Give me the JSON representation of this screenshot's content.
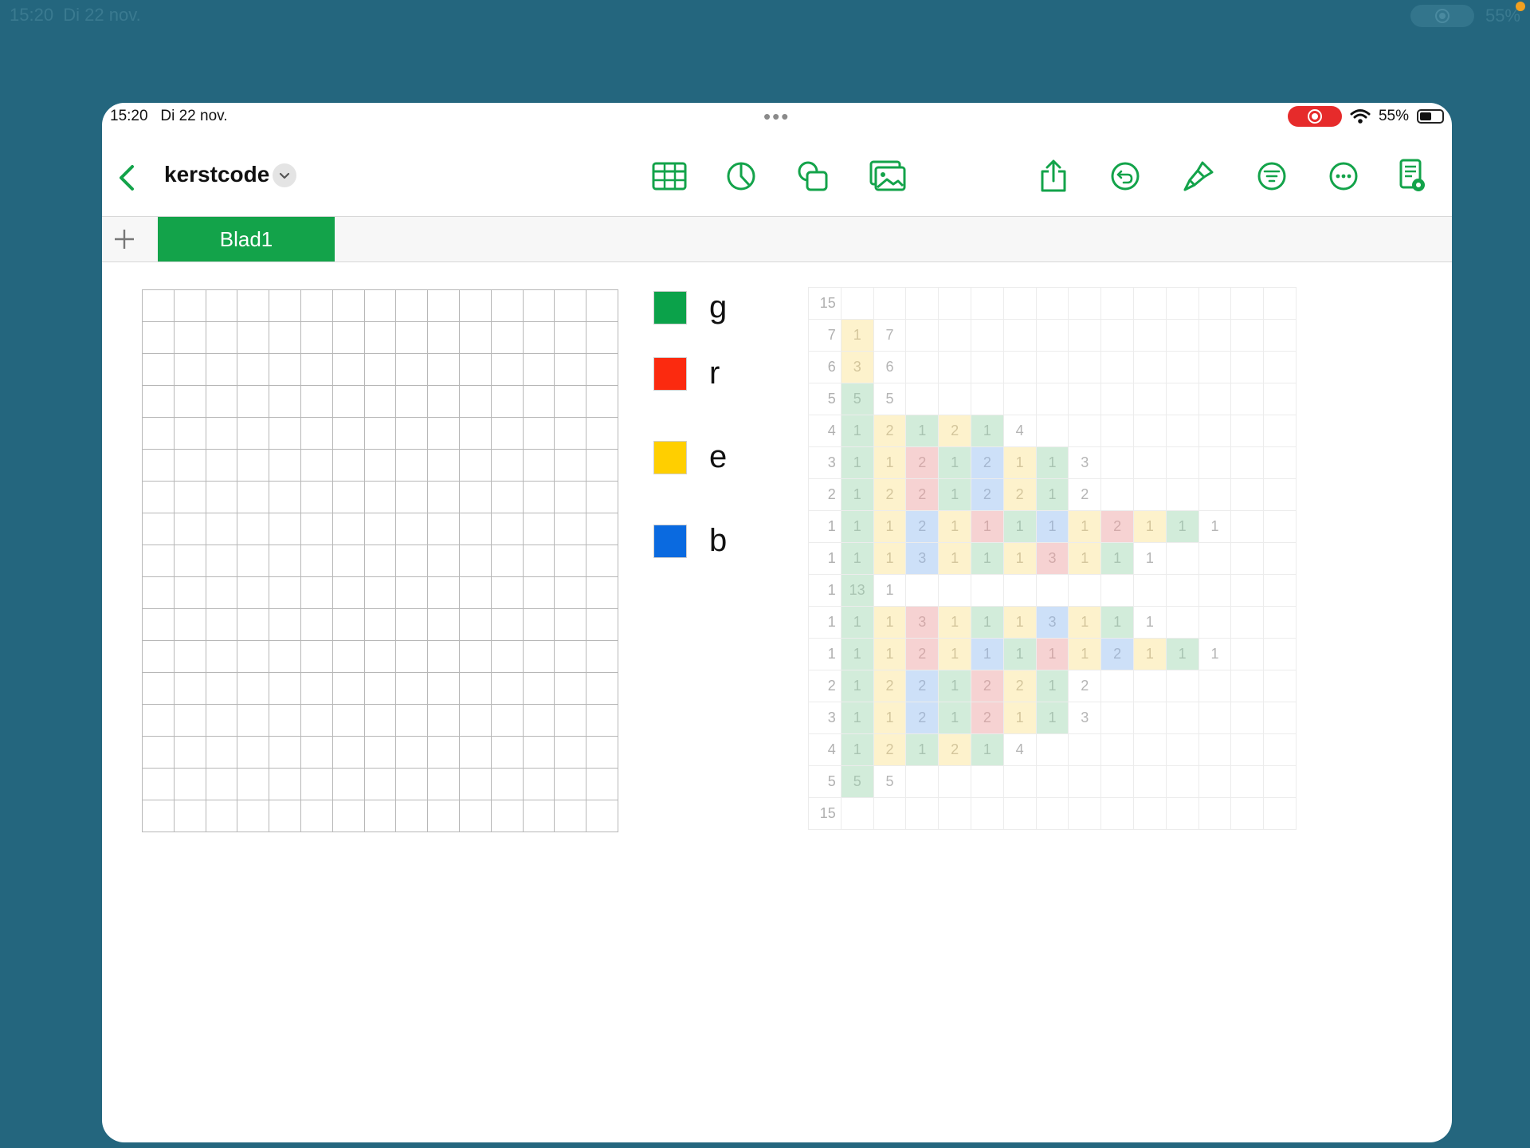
{
  "outer_status": {
    "time": "15:20",
    "date": "Di 22 nov.",
    "battery": "55%"
  },
  "status": {
    "time": "15:20",
    "date": "Di 22 nov.",
    "battery_percent": "55%",
    "battery_level": 0.55
  },
  "document": {
    "title": "kerstcode"
  },
  "toolbar": {
    "left": [
      {
        "name": "back-button",
        "icon": "chevron-left-icon",
        "interactable": true
      }
    ],
    "insert": [
      {
        "name": "table-button",
        "icon": "table-icon"
      },
      {
        "name": "chart-button",
        "icon": "chart-icon"
      },
      {
        "name": "shape-button",
        "icon": "shape-icon"
      },
      {
        "name": "media-button",
        "icon": "media-icon"
      }
    ],
    "actions": [
      {
        "name": "share-button",
        "icon": "share-icon"
      },
      {
        "name": "undo-button",
        "icon": "undo-icon"
      },
      {
        "name": "format-button",
        "icon": "paintbrush-icon"
      },
      {
        "name": "organize-button",
        "icon": "filter-icon"
      },
      {
        "name": "more-button",
        "icon": "ellipsis-icon"
      },
      {
        "name": "reader-button",
        "icon": "reader-view-icon"
      }
    ]
  },
  "sheets": {
    "tabs": [
      {
        "label": "Blad1",
        "active": true
      }
    ]
  },
  "colors": {
    "accent": "#13a34a",
    "g": "#0ba24a",
    "r": "#fb2a0f",
    "e": "#ffcf00",
    "b": "#0a6ae0"
  },
  "legend": [
    {
      "key": "g",
      "label": "g",
      "color": "#0ba24a"
    },
    {
      "key": "r",
      "label": "r",
      "color": "#fb2a0f"
    },
    {
      "key": "e",
      "label": "e",
      "color": "#ffcf00"
    },
    {
      "key": "b",
      "label": "b",
      "color": "#0a6ae0"
    }
  ],
  "empty_grid": {
    "rows": 17,
    "cols": 15
  },
  "clue_grid": {
    "columns": 15,
    "rows": [
      {
        "lead": "15",
        "cells": []
      },
      {
        "lead": "7",
        "cells": [
          [
            "e",
            "1"
          ],
          [
            "",
            "7"
          ]
        ]
      },
      {
        "lead": "6",
        "cells": [
          [
            "e",
            "3"
          ],
          [
            "",
            "6"
          ]
        ]
      },
      {
        "lead": "5",
        "cells": [
          [
            "g",
            "5"
          ],
          [
            "",
            "5"
          ]
        ]
      },
      {
        "lead": "4",
        "cells": [
          [
            "g",
            "1"
          ],
          [
            "e",
            "2"
          ],
          [
            "g",
            "1"
          ],
          [
            "e",
            "2"
          ],
          [
            "g",
            "1"
          ],
          [
            "",
            "4"
          ]
        ]
      },
      {
        "lead": "3",
        "cells": [
          [
            "g",
            "1"
          ],
          [
            "e",
            "1"
          ],
          [
            "r",
            "2"
          ],
          [
            "g",
            "1"
          ],
          [
            "b",
            "2"
          ],
          [
            "e",
            "1"
          ],
          [
            "g",
            "1"
          ],
          [
            "",
            "3"
          ]
        ]
      },
      {
        "lead": "2",
        "cells": [
          [
            "g",
            "1"
          ],
          [
            "e",
            "2"
          ],
          [
            "r",
            "2"
          ],
          [
            "g",
            "1"
          ],
          [
            "b",
            "2"
          ],
          [
            "e",
            "2"
          ],
          [
            "g",
            "1"
          ],
          [
            "",
            "2"
          ]
        ]
      },
      {
        "lead": "1",
        "cells": [
          [
            "g",
            "1"
          ],
          [
            "e",
            "1"
          ],
          [
            "b",
            "2"
          ],
          [
            "e",
            "1"
          ],
          [
            "r",
            "1"
          ],
          [
            "g",
            "1"
          ],
          [
            "b",
            "1"
          ],
          [
            "e",
            "1"
          ],
          [
            "r",
            "2"
          ],
          [
            "e",
            "1"
          ],
          [
            "g",
            "1"
          ],
          [
            "",
            "1"
          ]
        ]
      },
      {
        "lead": "1",
        "cells": [
          [
            "g",
            "1"
          ],
          [
            "e",
            "1"
          ],
          [
            "b",
            "3"
          ],
          [
            "e",
            "1"
          ],
          [
            "g",
            "1"
          ],
          [
            "e",
            "1"
          ],
          [
            "r",
            "3"
          ],
          [
            "e",
            "1"
          ],
          [
            "g",
            "1"
          ],
          [
            "",
            "1"
          ]
        ]
      },
      {
        "lead": "1",
        "cells": [
          [
            "g",
            "13"
          ],
          [
            "",
            "1"
          ]
        ]
      },
      {
        "lead": "1",
        "cells": [
          [
            "g",
            "1"
          ],
          [
            "e",
            "1"
          ],
          [
            "r",
            "3"
          ],
          [
            "e",
            "1"
          ],
          [
            "g",
            "1"
          ],
          [
            "e",
            "1"
          ],
          [
            "b",
            "3"
          ],
          [
            "e",
            "1"
          ],
          [
            "g",
            "1"
          ],
          [
            "",
            "1"
          ]
        ]
      },
      {
        "lead": "1",
        "cells": [
          [
            "g",
            "1"
          ],
          [
            "e",
            "1"
          ],
          [
            "r",
            "2"
          ],
          [
            "e",
            "1"
          ],
          [
            "b",
            "1"
          ],
          [
            "g",
            "1"
          ],
          [
            "r",
            "1"
          ],
          [
            "e",
            "1"
          ],
          [
            "b",
            "2"
          ],
          [
            "e",
            "1"
          ],
          [
            "g",
            "1"
          ],
          [
            "",
            "1"
          ]
        ]
      },
      {
        "lead": "2",
        "cells": [
          [
            "g",
            "1"
          ],
          [
            "e",
            "2"
          ],
          [
            "b",
            "2"
          ],
          [
            "g",
            "1"
          ],
          [
            "r",
            "2"
          ],
          [
            "e",
            "2"
          ],
          [
            "g",
            "1"
          ],
          [
            "",
            "2"
          ]
        ]
      },
      {
        "lead": "3",
        "cells": [
          [
            "g",
            "1"
          ],
          [
            "e",
            "1"
          ],
          [
            "b",
            "2"
          ],
          [
            "g",
            "1"
          ],
          [
            "r",
            "2"
          ],
          [
            "e",
            "1"
          ],
          [
            "g",
            "1"
          ],
          [
            "",
            "3"
          ]
        ]
      },
      {
        "lead": "4",
        "cells": [
          [
            "g",
            "1"
          ],
          [
            "e",
            "2"
          ],
          [
            "g",
            "1"
          ],
          [
            "e",
            "2"
          ],
          [
            "g",
            "1"
          ],
          [
            "",
            "4"
          ]
        ]
      },
      {
        "lead": "5",
        "cells": [
          [
            "g",
            "5"
          ],
          [
            "",
            "5"
          ]
        ]
      },
      {
        "lead": "15",
        "cells": []
      }
    ]
  }
}
